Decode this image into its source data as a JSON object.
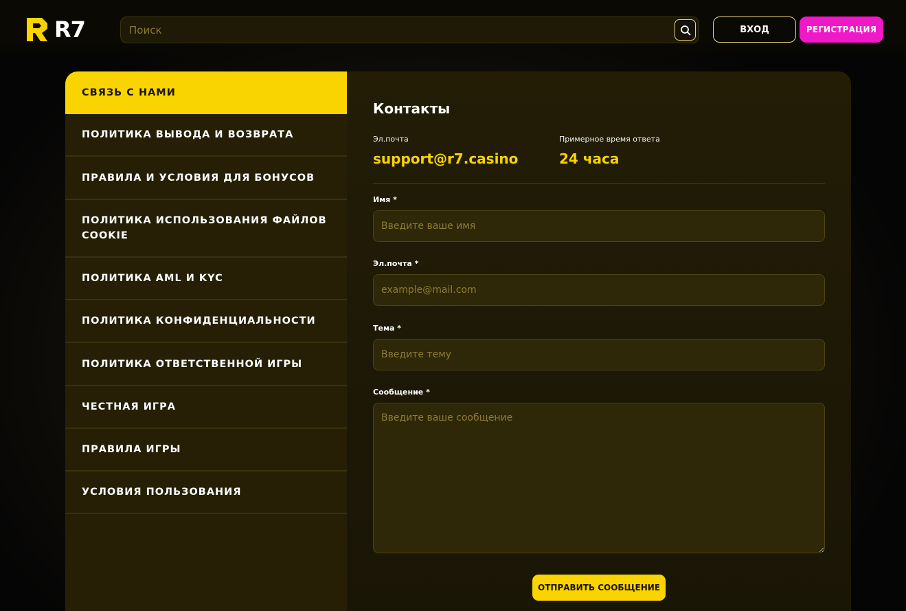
{
  "header": {
    "logo_text": "R7",
    "search_placeholder": "Поиск",
    "login_label": "ВХОД",
    "register_label": "РЕГИСТРАЦИЯ"
  },
  "sidebar": {
    "items": [
      {
        "label": "СВЯЗЬ С НАМИ",
        "active": true
      },
      {
        "label": "ПОЛИТИКА ВЫВОДА И ВОЗВРАТА"
      },
      {
        "label": "ПРАВИЛА И УСЛОВИЯ ДЛЯ БОНУСОВ"
      },
      {
        "label": "ПОЛИТИКА ИСПОЛЬЗОВАНИЯ ФАЙЛОВ COOKIE"
      },
      {
        "label": "ПОЛИТИКА AML И KYC"
      },
      {
        "label": "ПОЛИТИКА КОНФИДЕНЦИАЛЬНОСТИ"
      },
      {
        "label": "ПОЛИТИКА ОТВЕТСТВЕННОЙ ИГРЫ"
      },
      {
        "label": "ЧЕСТНАЯ ИГРА"
      },
      {
        "label": "ПРАВИЛА ИГРЫ"
      },
      {
        "label": "УСЛОВИЯ ПОЛЬЗОВАНИЯ"
      }
    ]
  },
  "contacts": {
    "title": "Контакты",
    "email_label": "Эл.почта",
    "email_value": "support@r7.casino",
    "response_label": "Примерное время ответа",
    "response_value": "24 часа"
  },
  "form": {
    "name_label": "Имя *",
    "name_placeholder": "Введите ваше имя",
    "email_label": "Эл.почта *",
    "email_placeholder": "example@mail.com",
    "subject_label": "Тема *",
    "subject_placeholder": "Введите тему",
    "message_label": "Сообщение *",
    "message_placeholder": "Введите ваше сообщение",
    "submit_label": "ОТПРАВИТЬ СООБЩЕНИЕ"
  },
  "colors": {
    "accent": "#fad400",
    "register": "#f019c8"
  }
}
